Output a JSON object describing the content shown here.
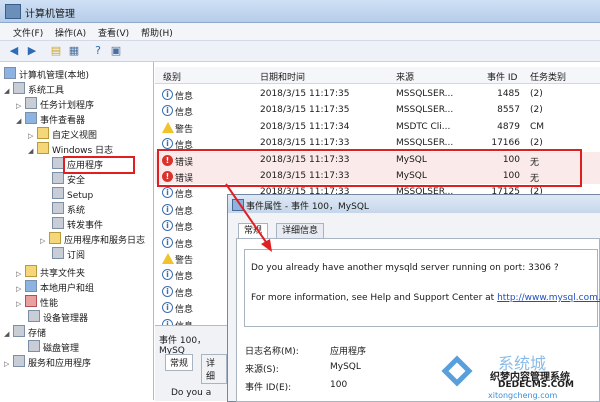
{
  "window": {
    "title": "计算机管理"
  },
  "menu": [
    "文件(F)",
    "操作(A)",
    "查看(V)",
    "帮助(H)"
  ],
  "tree": [
    {
      "label": "计算机管理(本地)"
    },
    {
      "label": "系统工具"
    },
    {
      "label": "任务计划程序"
    },
    {
      "label": "事件查看器"
    },
    {
      "label": "自定义视图"
    },
    {
      "label": "Windows 日志"
    },
    {
      "label": "应用程序"
    },
    {
      "label": "安全"
    },
    {
      "label": "Setup"
    },
    {
      "label": "系统"
    },
    {
      "label": "转发事件"
    },
    {
      "label": "应用程序和服务日志"
    },
    {
      "label": "订阅"
    },
    {
      "label": "共享文件夹"
    },
    {
      "label": "本地用户和组"
    },
    {
      "label": "性能"
    },
    {
      "label": "设备管理器"
    },
    {
      "label": "存储"
    },
    {
      "label": "磁盘管理"
    },
    {
      "label": "服务和应用程序"
    }
  ],
  "columns": [
    "级别",
    "日期和时间",
    "来源",
    "事件 ID",
    "任务类别"
  ],
  "events": [
    {
      "level": "信息",
      "type": "info",
      "datetime": "2018/3/15 11:17:35",
      "source": "MSSQLSER...",
      "id": "1485",
      "category": "(2)"
    },
    {
      "level": "信息",
      "type": "info",
      "datetime": "2018/3/15 11:17:35",
      "source": "MSSQLSER...",
      "id": "8557",
      "category": "(2)"
    },
    {
      "level": "警告",
      "type": "warn",
      "datetime": "2018/3/15 11:17:34",
      "source": "MSDTC Cli...",
      "id": "4879",
      "category": "CM"
    },
    {
      "level": "信息",
      "type": "info",
      "datetime": "2018/3/15 11:17:33",
      "source": "MSSQLSER...",
      "id": "17166",
      "category": "(2)"
    },
    {
      "level": "错误",
      "type": "err",
      "datetime": "2018/3/15 11:17:33",
      "source": "MySQL",
      "id": "100",
      "category": "无"
    },
    {
      "level": "错误",
      "type": "err",
      "datetime": "2018/3/15 11:17:33",
      "source": "MySQL",
      "id": "100",
      "category": "无"
    },
    {
      "level": "信息",
      "type": "info",
      "datetime": "2018/3/15 11:17:33",
      "source": "MSSQLSER...",
      "id": "17125",
      "category": "(2)"
    },
    {
      "level": "信息",
      "type": "info",
      "datetime": "",
      "source": "",
      "id": "",
      "category": ""
    },
    {
      "level": "信息",
      "type": "info",
      "datetime": "",
      "source": "",
      "id": "",
      "category": ""
    },
    {
      "level": "信息",
      "type": "info",
      "datetime": "",
      "source": "",
      "id": "",
      "category": ""
    },
    {
      "level": "警告",
      "type": "warn",
      "datetime": "",
      "source": "",
      "id": "",
      "category": ""
    },
    {
      "level": "信息",
      "type": "info",
      "datetime": "",
      "source": "",
      "id": "",
      "category": ""
    },
    {
      "level": "信息",
      "type": "info",
      "datetime": "",
      "source": "",
      "id": "",
      "category": ""
    },
    {
      "level": "信息",
      "type": "info",
      "datetime": "",
      "source": "",
      "id": "",
      "category": ""
    },
    {
      "level": "信息",
      "type": "info",
      "datetime": "",
      "source": "",
      "id": "",
      "category": ""
    },
    {
      "level": "信息",
      "type": "info",
      "datetime": "",
      "source": "",
      "id": "",
      "category": ""
    }
  ],
  "bottom_panel": {
    "title": "事件 100，MySQ",
    "tab_general": "常规",
    "tab_detail": "详细",
    "text": "Do you a"
  },
  "dialog": {
    "title": "事件属性 - 事件 100，MySQL",
    "tab_general": "常规",
    "tab_detail": "详细信息",
    "message_line1": "Do you already have another mysqld server running on port: 3306 ?",
    "message_line2_prefix": "For more information, see Help and Support Center at",
    "message_link": "http://www.mysql.com.",
    "fields": [
      {
        "label": "日志名称(M):",
        "value": "应用程序"
      },
      {
        "label": "来源(S):",
        "value": "MySQL"
      },
      {
        "label": "事件 ID(E):",
        "value": "100"
      }
    ]
  },
  "watermark": {
    "brand": "系统城",
    "line": "织梦内容管理系统",
    "domain": "DEDECMS.COM",
    "site": "xitongcheng.com"
  }
}
